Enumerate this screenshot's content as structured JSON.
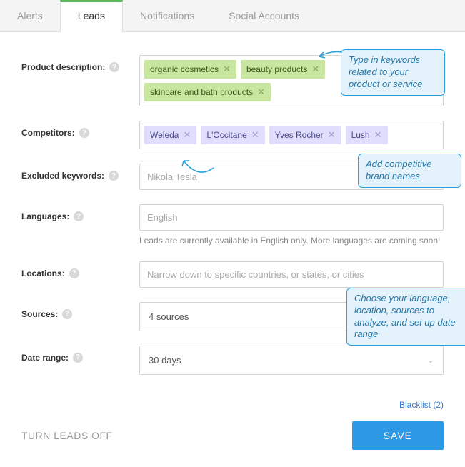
{
  "tabs": {
    "alerts": "Alerts",
    "leads": "Leads",
    "notifications": "Notifications",
    "social": "Social Accounts"
  },
  "rows": {
    "product_desc": {
      "label": "Product description:"
    },
    "competitors": {
      "label": "Competitors:"
    },
    "excluded": {
      "label": "Excluded keywords:",
      "placeholder": "Nikola Tesla"
    },
    "languages": {
      "label": "Languages:",
      "placeholder": "English",
      "helper": "Leads are currently available in English only. More languages are coming soon!"
    },
    "locations": {
      "label": "Locations:",
      "placeholder": "Narrow down to specific countries, or states, or cities"
    },
    "sources": {
      "label": "Sources:",
      "value": "4 sources"
    },
    "date_range": {
      "label": "Date range:",
      "value": "30 days"
    }
  },
  "product_tags": {
    "0": "organic cosmetics",
    "1": "beauty products",
    "2": "skincare and bath products"
  },
  "competitor_tags": {
    "0": "Weleda",
    "1": "L'Occitane",
    "2": "Yves Rocher",
    "3": "Lush"
  },
  "callouts": {
    "keywords": "Type in keywords related to your product or service",
    "competitors": "Add competitive brand names",
    "sources": "Choose your language, location, sources to analyze, and set up date range"
  },
  "blacklist": "Blacklist (2)",
  "turn_off": "TURN LEADS OFF",
  "save": "SAVE"
}
